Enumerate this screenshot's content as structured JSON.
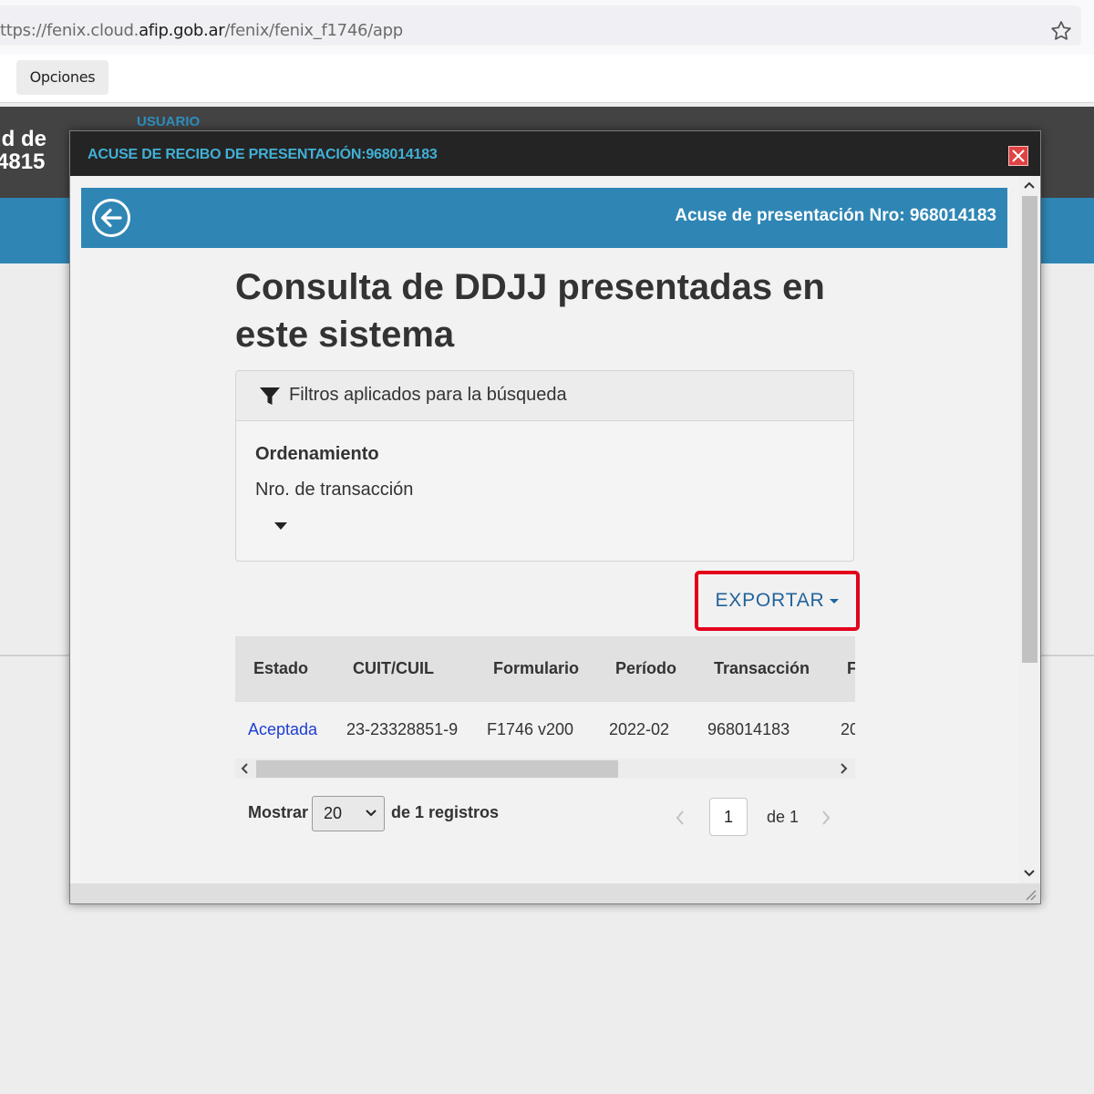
{
  "browser": {
    "url_prefix": "ttps://fenix.cloud.",
    "url_domain": "afip.gob.ar",
    "url_path": "/fenix/fenix_f1746/app",
    "menu_button": "Opciones"
  },
  "background_app": {
    "user_label": "USUARIO",
    "title_line1": "ud de",
    "title_line2": "4815"
  },
  "dialog": {
    "title": "ACUSE DE RECIBO DE PRESENTACIÓN:968014183",
    "header_title": "Acuse de presentación Nro: 968014183",
    "main_title": "Consulta de DDJJ presentadas en este sistema",
    "filters": {
      "title": "Filtros aplicados para la búsqueda",
      "order_label": "Ordenamiento",
      "order_value": "Nro. de transacción"
    },
    "export_label": "EXPORTAR",
    "table": {
      "columns": [
        "Estado",
        "CUIT/CUIL",
        "Formulario",
        "Período",
        "Transacción",
        "F"
      ],
      "rows": [
        [
          "Aceptada",
          "23-23328851-9",
          "F1746 v200",
          "2022-02",
          "968014183",
          "20"
        ]
      ]
    },
    "pagination": {
      "show_label": "Mostrar",
      "page_size": "20",
      "records_label": "de 1 registros",
      "current_page": "1",
      "of_pages": "de 1"
    }
  },
  "colors": {
    "accent_blue": "#2f86b5",
    "title_bar": "#242424",
    "highlight_red": "#e3001b",
    "link": "#1f3ed1"
  }
}
